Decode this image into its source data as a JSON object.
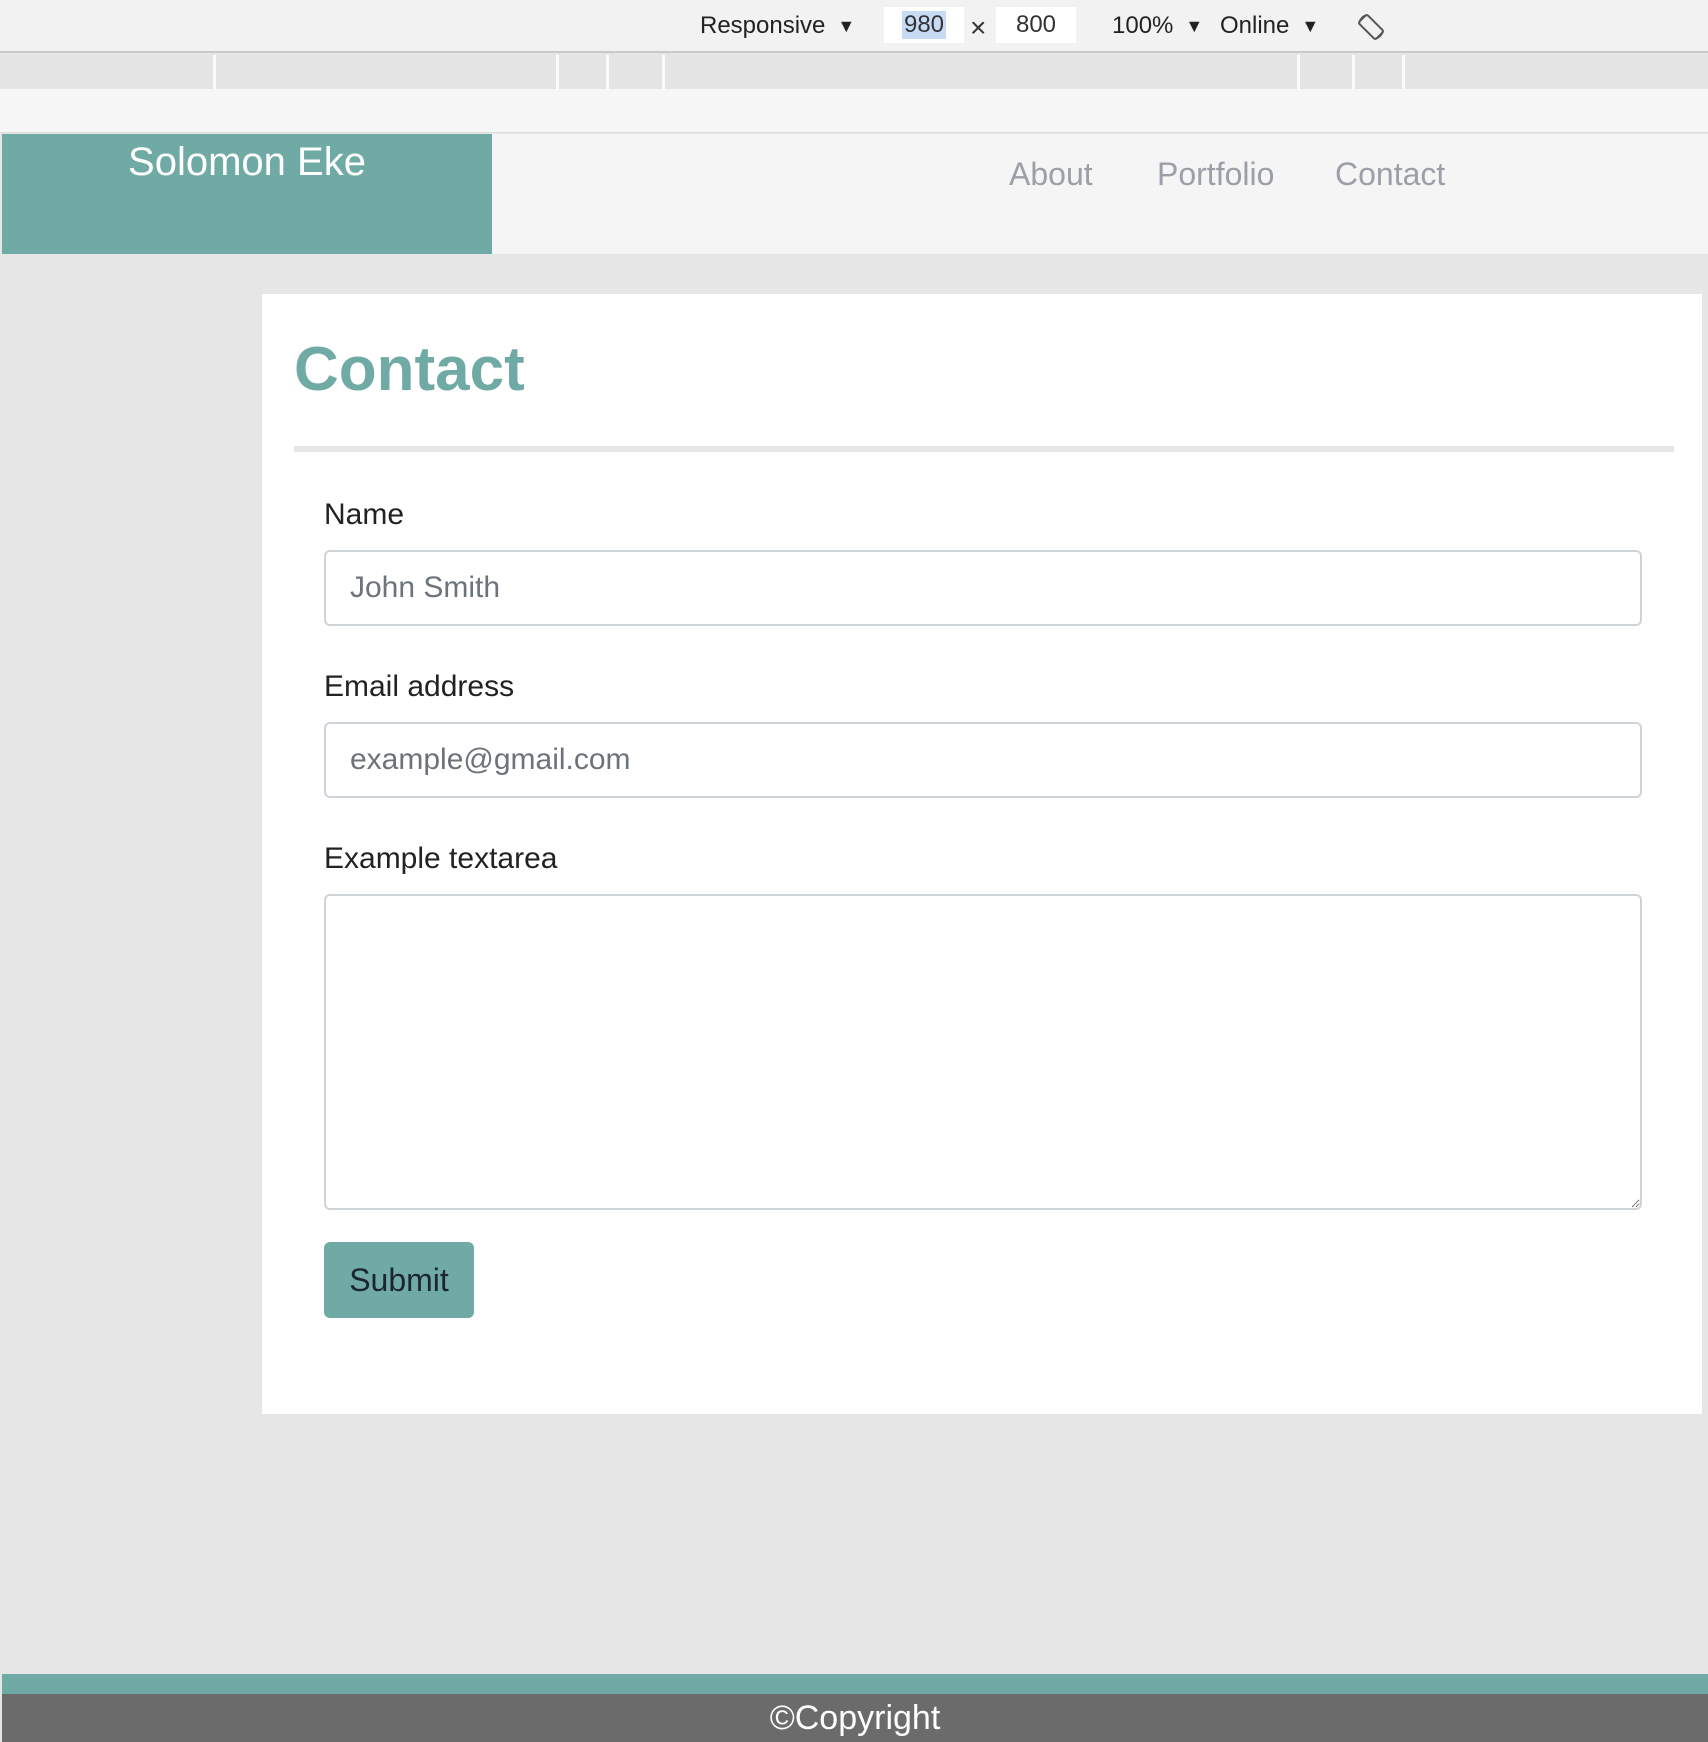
{
  "devtools": {
    "device": "Responsive",
    "width": "980",
    "height": "800",
    "times": "×",
    "zoom": "100%",
    "network": "Online",
    "dropdown_glyph": "▼"
  },
  "navbar": {
    "brand": "Solomon Eke",
    "links": [
      "About",
      "Portfolio",
      "Contact"
    ]
  },
  "contact": {
    "title": "Contact",
    "name_label": "Name",
    "name_placeholder": "John Smith",
    "email_label": "Email address",
    "email_placeholder": "example@gmail.com",
    "textarea_label": "Example textarea",
    "submit_label": "Submit"
  },
  "footer": {
    "text": "©Copyright"
  },
  "colors": {
    "accent": "#70aaa5",
    "footer": "#6b6b6b",
    "page_bg": "#e6e6e6"
  }
}
